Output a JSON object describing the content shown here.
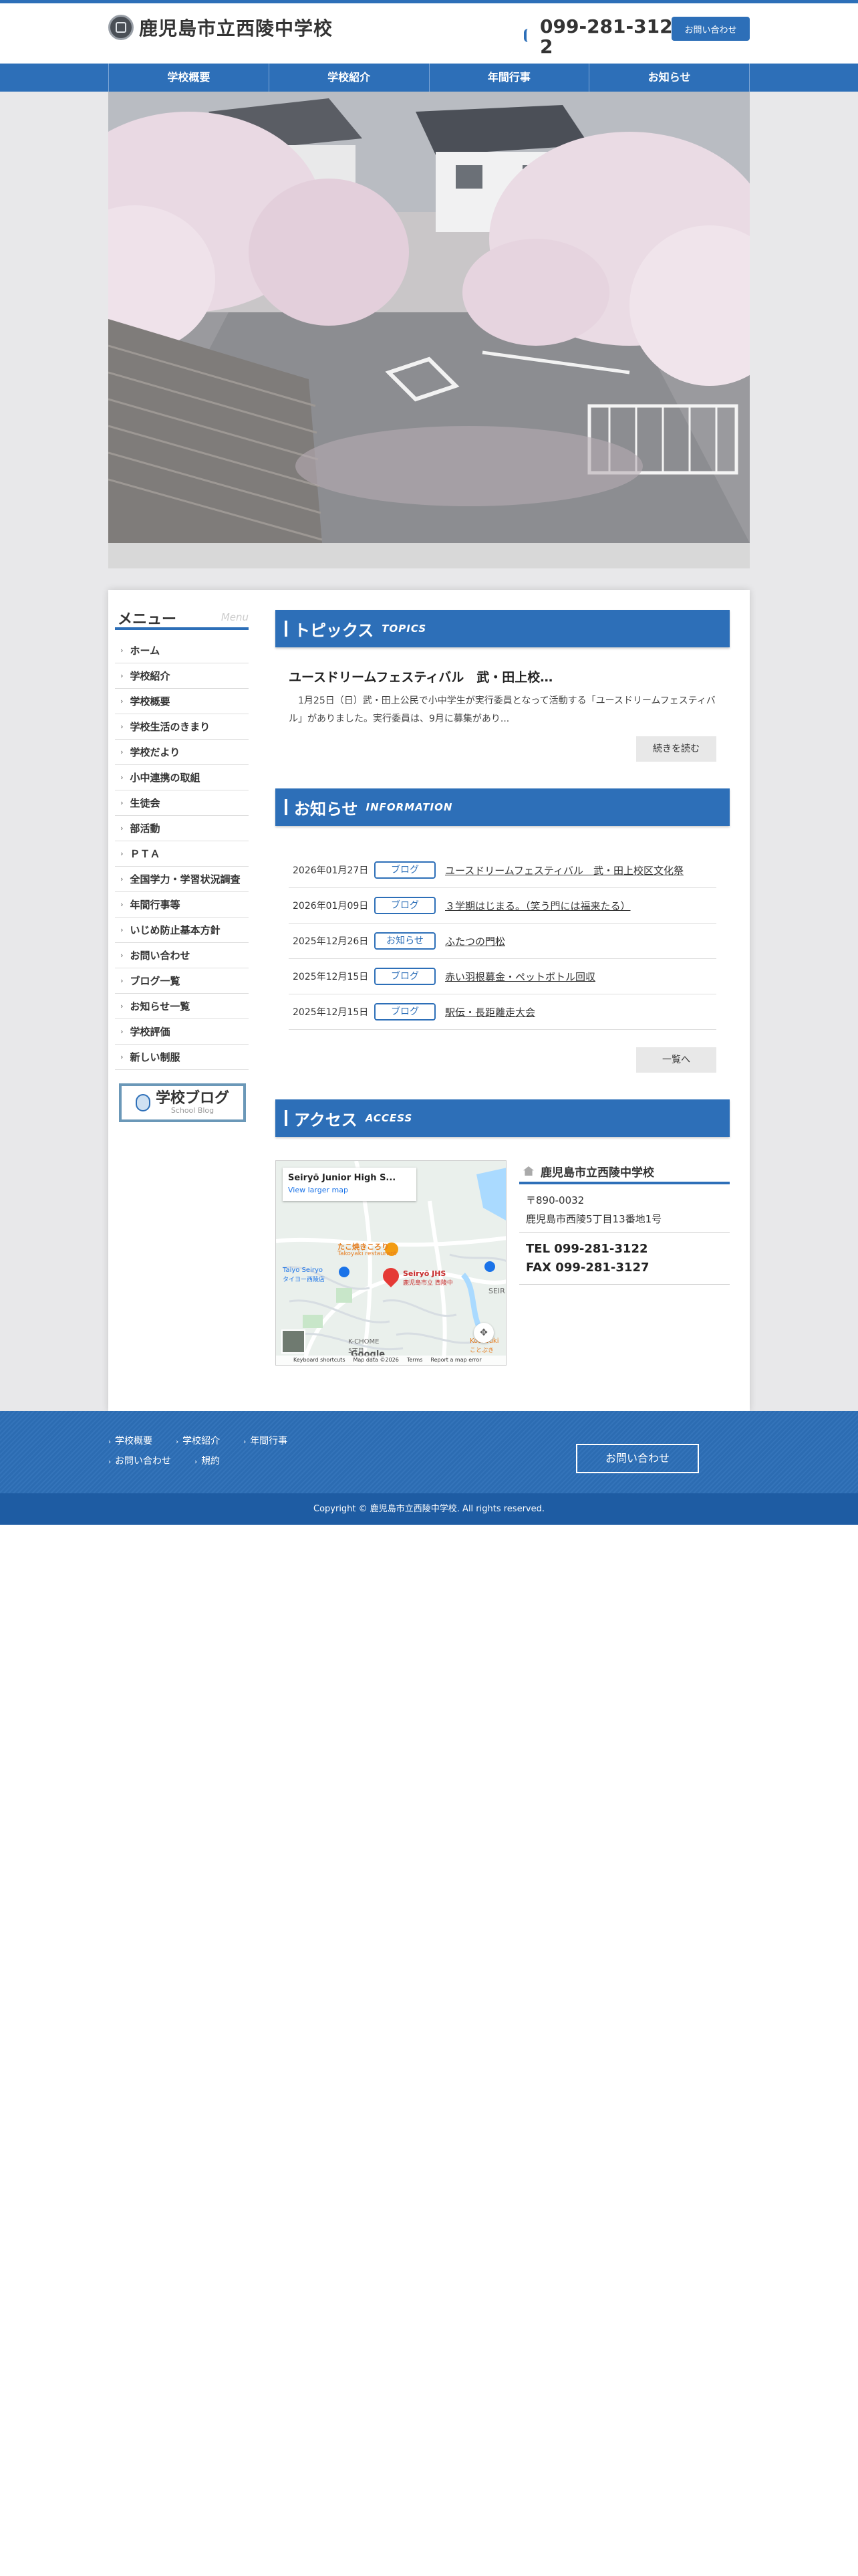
{
  "header": {
    "school_name": "鹿児島市立西陵中学校",
    "tel": "099-281-3122",
    "contact_label": "お問い合わせ"
  },
  "gnav": [
    "学校概要",
    "学校紹介",
    "年間行事",
    "お知らせ"
  ],
  "sidebar": {
    "title": "メニュー",
    "title_en": "Menu",
    "items": [
      "ホーム",
      "学校紹介",
      "学校概要",
      "学校生活のきまり",
      "学校だより",
      "小中連携の取組",
      "生徒会",
      "部活動",
      "ＰＴＡ",
      "全国学力・学習状況調査",
      "年間行事等",
      "いじめ防止基本方針",
      "お問い合わせ",
      "ブログ一覧",
      "お知らせ一覧",
      "学校評価",
      "新しい制服"
    ],
    "blog_banner_ja": "学校ブログ",
    "blog_banner_en": "School Blog"
  },
  "topics": {
    "heading": "トピックス",
    "heading_en": "TOPICS",
    "title": "ユースドリームフェスティバル　武・田上校…",
    "body": "　1月25日（日）武・田上公民で小中学生が実行委員となって活動する「ユースドリームフェスティバル」がありました。実行委員は、9月に募集があり...",
    "more_label": "続きを読む"
  },
  "news": {
    "heading": "お知らせ",
    "heading_en": "INFORMATION",
    "items": [
      {
        "date": "2026年01月27日",
        "badge": "ブログ",
        "title": "ユースドリームフェスティバル　武・田上校区文化祭"
      },
      {
        "date": "2026年01月09日",
        "badge": "ブログ",
        "title": "３学期はじまる。（笑う門には福来たる）"
      },
      {
        "date": "2025年12月26日",
        "badge": "お知らせ",
        "title": "ふたつの門松"
      },
      {
        "date": "2025年12月15日",
        "badge": "ブログ",
        "title": "赤い羽根募金・ペットボトル回収"
      },
      {
        "date": "2025年12月15日",
        "badge": "ブログ",
        "title": "駅伝・長距離走大会"
      }
    ],
    "list_label": "一覧へ"
  },
  "access": {
    "heading": "アクセス",
    "heading_en": "ACCESS",
    "name": "鹿児島市立西陵中学校",
    "postal": "〒890-0032",
    "address": "鹿児島市西陵5丁目13番地1号",
    "tel": "TEL 099-281-3122",
    "fax": "FAX 099-281-3127",
    "map": {
      "card_title": "Seiryō Junior High S...",
      "card_link": "View larger map",
      "label_takoyaki": "たこ焼きころり",
      "label_takoyaki_sub": "Takoyaki restaurant",
      "label_station": "Taiyo Seiryo",
      "label_station_sub": "タイヨー西陵店",
      "label_school": "Seiryō JHS",
      "label_school_sub": "鹿児島市立 西陵中",
      "label_seir": "SEIR",
      "label_kochome": "K-CHOME",
      "label_kochome_sub": "5丁目",
      "label_kotobuki": "Kotobuki",
      "label_kotobuki_sub": "ことぶき",
      "google": "Google",
      "shortcuts": "Keyboard shortcuts",
      "mapdata": "Map data ©2026",
      "terms": "Terms",
      "report": "Report a map error"
    }
  },
  "footer": {
    "links": [
      "学校概要",
      "学校紹介",
      "年間行事",
      "お問い合わせ",
      "規約"
    ],
    "contact_label": "お問い合わせ",
    "copyright": "Copyright © 鹿児島市立西陵中学校. All rights reserved."
  },
  "colors": {
    "primary": "#2d6fb8",
    "footer_dark": "#1e5ca3"
  }
}
